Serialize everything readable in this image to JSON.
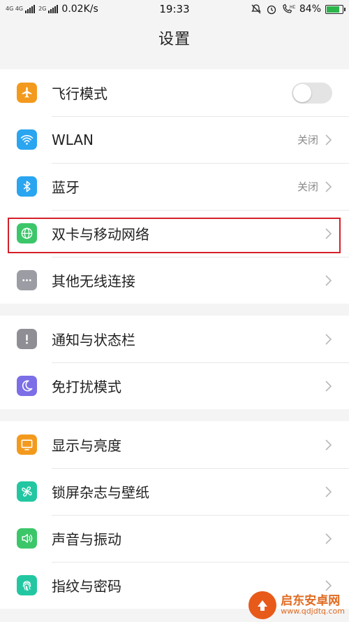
{
  "status_bar": {
    "network_type": "4G 4G",
    "network_type_2": "2G",
    "speed": "0.02K/s",
    "time": "19:33",
    "battery": "84%",
    "battery_level": 0.84,
    "icons": [
      "mute-icon",
      "alarm-icon",
      "hd-call-icon",
      "battery-icon"
    ]
  },
  "header": {
    "title": "设置"
  },
  "sections": [
    {
      "items": [
        {
          "label": "飞行模式",
          "icon": "airplane-icon",
          "color": "#f39a1e",
          "toggle": false
        },
        {
          "label": "WLAN",
          "icon": "wifi-icon",
          "color": "#2aa5f0",
          "value": "关闭"
        },
        {
          "label": "蓝牙",
          "icon": "bluetooth-icon",
          "color": "#2aa5f0",
          "value": "关闭"
        },
        {
          "label": "双卡与移动网络",
          "icon": "globe-icon",
          "color": "#3cc66a"
        },
        {
          "label": "其他无线连接",
          "icon": "more-dots-icon",
          "color": "#9c9ca4"
        }
      ]
    },
    {
      "items": [
        {
          "label": "通知与状态栏",
          "icon": "exclamation-icon",
          "color": "#8e8e94"
        },
        {
          "label": "免打扰模式",
          "icon": "moon-icon",
          "color": "#7b6ee6"
        }
      ]
    },
    {
      "items": [
        {
          "label": "显示与亮度",
          "icon": "monitor-icon",
          "color": "#f39a1e"
        },
        {
          "label": "锁屏杂志与壁纸",
          "icon": "pinwheel-icon",
          "color": "#22c7a2"
        },
        {
          "label": "声音与振动",
          "icon": "speaker-icon",
          "color": "#3cc66a"
        },
        {
          "label": "指纹与密码",
          "icon": "fingerprint-icon",
          "color": "#22c7a2"
        }
      ]
    }
  ],
  "watermark": {
    "name": "启东安卓网",
    "url": "www.qdjdtq.com"
  },
  "highlight_color": "#d4202a"
}
